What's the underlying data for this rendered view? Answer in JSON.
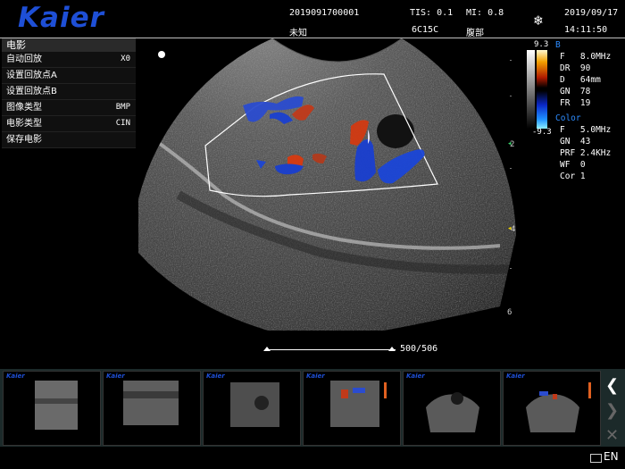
{
  "header": {
    "logo": "Kaier",
    "patient_id": "2019091700001",
    "patient_name": "未知",
    "tis": "TIS: 0.1",
    "mi": "MI: 0.8",
    "probe": "6C15C",
    "exam": "腹部",
    "date": "2019/09/17",
    "time": "14:11:50"
  },
  "menu": {
    "title": "电影",
    "items": [
      {
        "label": "自动回放",
        "value": "X0"
      },
      {
        "label": "设置回放点A",
        "value": ""
      },
      {
        "label": "设置回放点B",
        "value": ""
      },
      {
        "label": "图像类型",
        "value": "BMP"
      },
      {
        "label": "电影类型",
        "value": "CIN"
      },
      {
        "label": "保存电影",
        "value": ""
      }
    ]
  },
  "depth_scale": [
    "2",
    "4",
    "6"
  ],
  "color_bar": {
    "max": "9.3",
    "min": "-9.3",
    "b_label": "B"
  },
  "b_params": [
    {
      "k": "F",
      "v": "8.0MHz"
    },
    {
      "k": "DR",
      "v": "90"
    },
    {
      "k": "D",
      "v": "64mm"
    },
    {
      "k": "GN",
      "v": "78"
    },
    {
      "k": "FR",
      "v": "19"
    }
  ],
  "color_label": "Color",
  "color_params": [
    {
      "k": "F",
      "v": "5.0MHz"
    },
    {
      "k": "GN",
      "v": "43"
    },
    {
      "k": "PRF",
      "v": "2.4KHz"
    },
    {
      "k": "WF",
      "v": "0"
    },
    {
      "k": "Cor",
      "v": "1"
    }
  ],
  "cine": {
    "frame": "500/506",
    "current": 500,
    "total": 506
  },
  "thumbnails": [
    {
      "logo": "Kaier",
      "mode": "gray"
    },
    {
      "logo": "Kaier",
      "mode": "gray"
    },
    {
      "logo": "Kaier",
      "mode": "gray"
    },
    {
      "logo": "Kaier",
      "mode": "color"
    },
    {
      "logo": "Kaier",
      "mode": "gray"
    },
    {
      "logo": "Kaier",
      "mode": "color"
    }
  ],
  "nav": {
    "prev": "❮",
    "next": "❯",
    "close": "✕"
  },
  "status": {
    "lang": "EN"
  },
  "colors": {
    "logo": "#1e4fd6",
    "accent": "#2d8cff"
  }
}
